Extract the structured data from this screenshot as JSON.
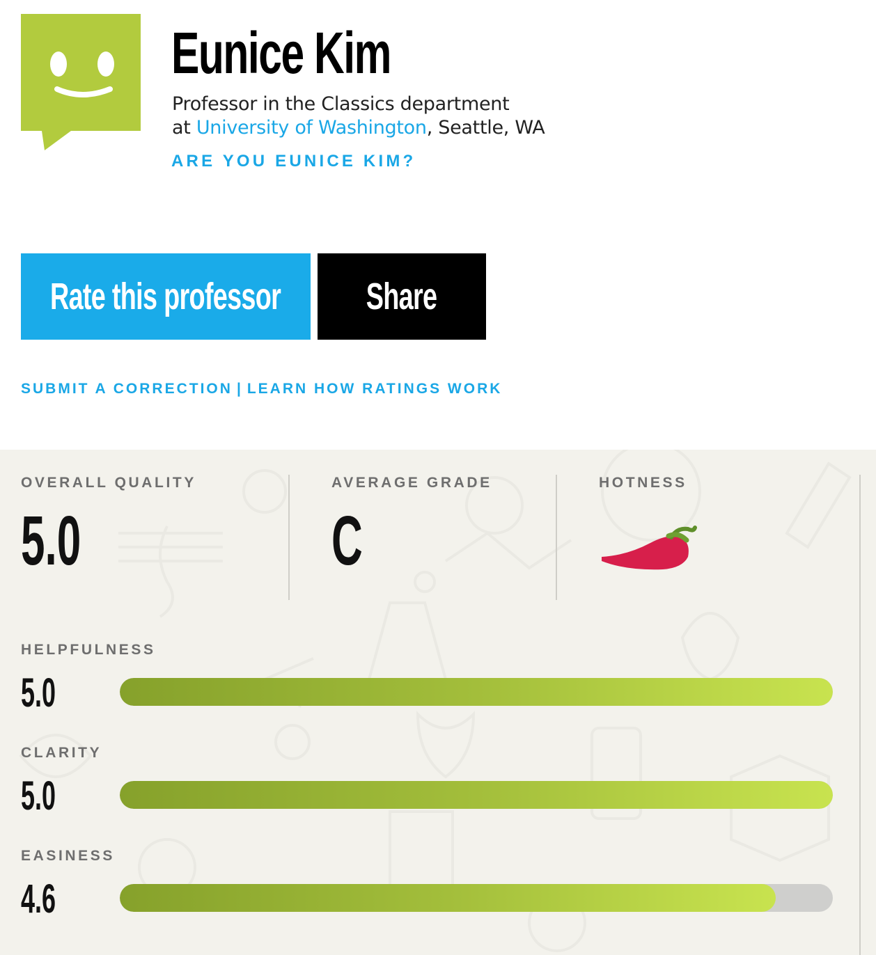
{
  "professor": {
    "name": "Eunice Kim",
    "title_prefix": "Professor in the",
    "department": "Classics",
    "title_suffix": "department",
    "at": "at",
    "school": "University of Washington",
    "location": ", Seattle, WA",
    "claim_link": "ARE YOU EUNICE KIM?"
  },
  "buttons": {
    "rate_label": "Rate this professor",
    "share_label": "Share"
  },
  "links": {
    "correction": "SUBMIT A CORRECTION",
    "separator": "|",
    "how_ratings": "LEARN HOW RATINGS WORK"
  },
  "summary": {
    "overall_quality_label": "OVERALL QUALITY",
    "overall_quality_value": "5.0",
    "average_grade_label": "AVERAGE GRADE",
    "average_grade_value": "C",
    "hotness_label": "HOTNESS",
    "hotness_icon": "chili-pepper-icon"
  },
  "ratings": [
    {
      "label": "HELPFULNESS",
      "value": "5.0",
      "fraction": 1.0
    },
    {
      "label": "CLARITY",
      "value": "5.0",
      "fraction": 1.0
    },
    {
      "label": "EASINESS",
      "value": "4.6",
      "fraction": 0.92
    }
  ],
  "colors": {
    "accent_blue": "#1aabe9",
    "avatar_green": "#b2cb3e",
    "bar_start": "#86a12b",
    "bar_end": "#c8e34f",
    "pepper_red": "#d71f4b"
  }
}
